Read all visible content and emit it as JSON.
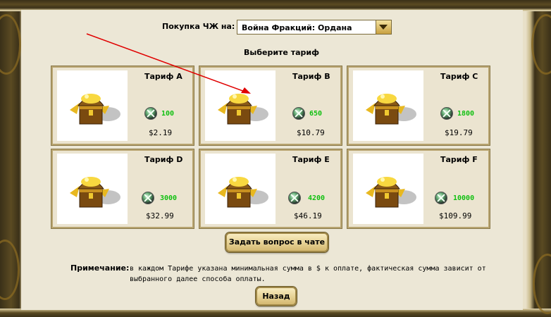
{
  "purchase": {
    "label": "Покупка ЧЖ на:",
    "selected": "Война Фракций: Ордана"
  },
  "heading": "Выберите тариф",
  "tariffs": [
    {
      "title": "Тариф А",
      "amount": "100",
      "price": "$2.19"
    },
    {
      "title": "Тариф В",
      "amount": "650",
      "price": "$10.79"
    },
    {
      "title": "Тариф С",
      "amount": "1800",
      "price": "$19.79"
    },
    {
      "title": "Тариф D",
      "amount": "3000",
      "price": "$32.99"
    },
    {
      "title": "Тариф Е",
      "amount": "4200",
      "price": "$46.19"
    },
    {
      "title": "Тариф F",
      "amount": "10000",
      "price": "$109.99"
    }
  ],
  "chat_button": "Задать вопрос в чате",
  "note": {
    "label": "Примечание:",
    "text": "в каждом Тарифе указана минимальная сумма в $ к оплате, фактическая сумма зависит от выбранного далее способа оплаты."
  },
  "back_button": "Назад",
  "colors": {
    "amount": "#10c010",
    "panel": "#ece7d6",
    "arrow": "#e00000"
  },
  "icons": {
    "currency": "gem-icon",
    "tariff_image": "treasure-chest-icon"
  }
}
